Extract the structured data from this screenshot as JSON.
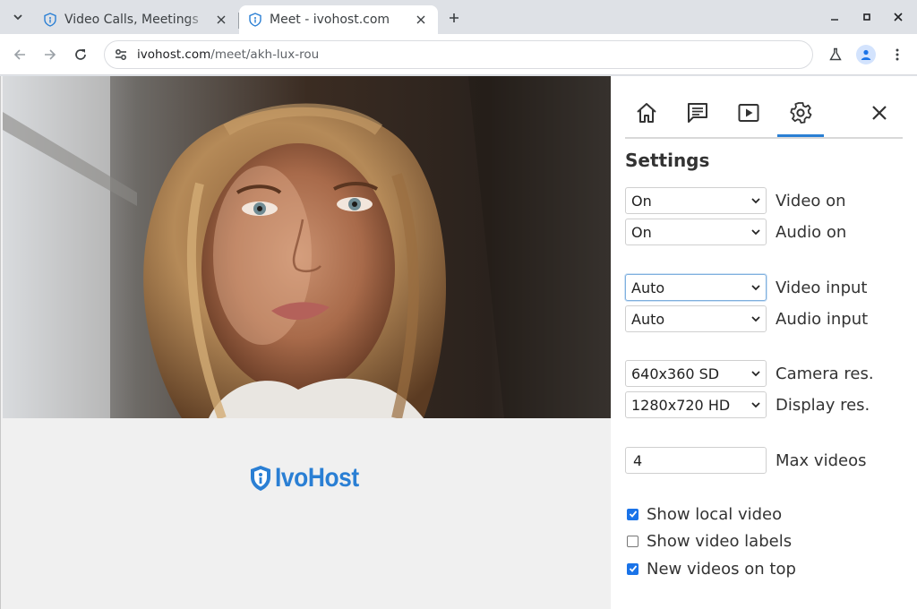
{
  "browser": {
    "tabs": [
      {
        "title": "Video Calls, Meetings",
        "active": false
      },
      {
        "title": "Meet - ivohost.com",
        "active": true
      }
    ],
    "url_domain": "ivohost.com",
    "url_path": "/meet/akh-lux-rou"
  },
  "brand": {
    "name": "IvoHost",
    "color": "#2a7fd4"
  },
  "panel": {
    "title": "Settings",
    "nav_icons": [
      "home-icon",
      "chat-icon",
      "play-icon",
      "gear-icon",
      "close-icon"
    ],
    "rows": {
      "video_on": {
        "value": "On",
        "label": "Video on"
      },
      "audio_on": {
        "value": "On",
        "label": "Audio on"
      },
      "video_input": {
        "value": "Auto",
        "label": "Video input"
      },
      "audio_input": {
        "value": "Auto",
        "label": "Audio input"
      },
      "camera_res": {
        "value": "640x360 SD",
        "label": "Camera res."
      },
      "display_res": {
        "value": "1280x720 HD",
        "label": "Display res."
      },
      "max_videos": {
        "value": "4",
        "label": "Max videos"
      }
    },
    "checkboxes": {
      "show_local_video": {
        "label": "Show local video",
        "checked": true
      },
      "show_video_labels": {
        "label": "Show video labels",
        "checked": false
      },
      "new_videos_on_top": {
        "label": "New videos on top",
        "checked": true
      }
    }
  },
  "colors": {
    "accent": "#1a73e8",
    "brand": "#2a7fd4"
  }
}
